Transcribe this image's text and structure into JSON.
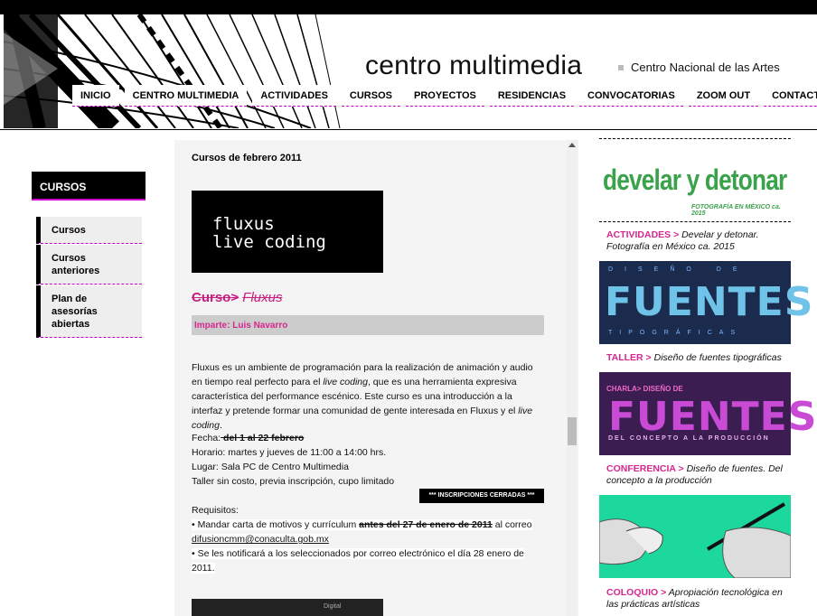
{
  "header": {
    "brand": "centro multimedia",
    "brand_sub": "Centro Nacional de las Artes",
    "nav": [
      "INICIO",
      "CENTRO MULTIMEDIA",
      "ACTIVIDADES",
      "CURSOS",
      "PROYECTOS",
      "RESIDENCIAS",
      "CONVOCATORIAS",
      "ZOOM OUT",
      "CONTACTO"
    ]
  },
  "sidebar": {
    "title": "CURSOS",
    "items": [
      "Cursos",
      "Cursos anteriores",
      "Plan de asesorías abiertas"
    ]
  },
  "main": {
    "month_title": "Cursos de febrero 2011",
    "image_text": "fluxus\nlive coding",
    "course_label": "Curso>",
    "course_name": "Fluxus",
    "imparte": "Imparte: Luis Navarro",
    "description_1": "Fluxus es un ambiente de programación para la realización de animación y audio en tiempo real perfecto para el ",
    "description_em1": "live coding",
    "description_2": ", que es una herramienta expresiva característica del performance escénico. Este curso es una introducción a la interfaz y pretende formar una comunidad de gente interesada en Fluxus y el ",
    "description_em2": "live coding",
    "description_3": ".",
    "fecha_label": "Fecha:",
    "fecha_value": " del 1 al 22 febrero",
    "horario": "Horario: martes y jueves de 11:00 a 14:00 hrs.",
    "lugar": "Lugar: Sala PC de Centro Multimedia",
    "costo": "Taller sin costo, previa inscripción, cupo limitado",
    "closed_badge": "*** INSCRIPCIONES CERRADAS ***",
    "req_title": "Requisitos:",
    "req1_a": "• Mandar carta de motivos y currículum ",
    "req1_strike": "antes del 27 de enero de 2011",
    "req1_b": " al correo",
    "req1_email": "difusioncmm@conaculta.gob.mx",
    "req2": "• Se les notificará a los seleccionados por correo electrónico el día 28 enero de 2011.",
    "bottom_image_text": "Digital"
  },
  "right": {
    "promo1_title": "develar y detonar",
    "promo1_sub": "FOTOGRAFÍA EN MÉXICO ca. 2015",
    "items": [
      {
        "cat": "ACTIVIDADES >",
        "desc": " Develar y detonar. Fotografía en México ca. 2015"
      },
      {
        "cat": "TALLER >",
        "desc": " Diseño de fuentes tipográficas"
      },
      {
        "cat": "CONFERENCIA >",
        "desc": " Diseño de fuentes. Del concepto a la producción"
      },
      {
        "cat": "COLOQUIO >",
        "desc": " Apropiación tecnológica en las prácticas artísticas"
      }
    ],
    "fuentes1_top": "DISEÑO DE",
    "fuentes1_big": "FUENTES",
    "fuentes1_bottom": "TIPOGRÁFICAS",
    "fuentes2_top": "CHARLA> DISEÑO DE",
    "fuentes2_big": "FUENTES",
    "fuentes2_bottom": "DEL CONCEPTO A LA PRODUCCIÓN"
  }
}
